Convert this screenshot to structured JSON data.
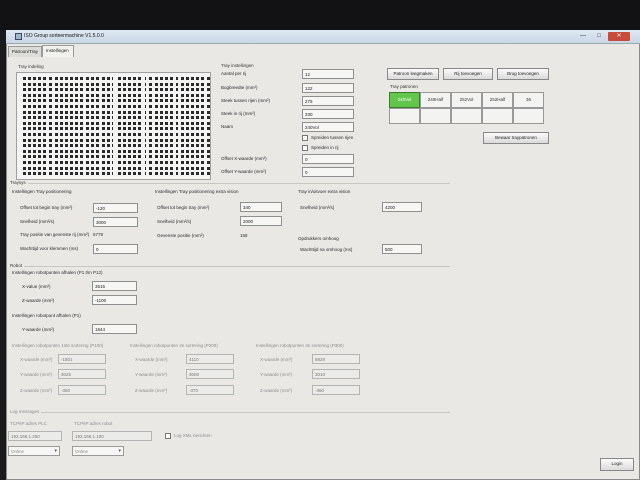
{
  "window": {
    "title": "ISO Group sorteermachine V1.5.0.0",
    "min_glyph": "—",
    "max_glyph": "□",
    "close_glyph": "✕"
  },
  "tabs": [
    {
      "label": "Patroon/Tray"
    },
    {
      "label": "Instellingen"
    }
  ],
  "tray_indeling": {
    "label": "Tray indeling"
  },
  "tray_instellingen": {
    "title": "Tray instellingen",
    "rows": [
      {
        "label": "Aantal per rij",
        "value": "12"
      },
      {
        "label": "Bugbreedte (mm²)",
        "value": "122"
      },
      {
        "label": "Steek tussen rijen (mm²)",
        "value": "275"
      },
      {
        "label": "Steek in rij (mm²)",
        "value": "330"
      },
      {
        "label": "Naam",
        "value": "240Vol"
      }
    ],
    "checkbox1": "Spreiden tussen rijen",
    "checkbox2": "Spreiden in rij",
    "offset_x_label": "Offset X-waarde (mm²)",
    "offset_x_value": "0",
    "offset_y_label": "Offset Y-waarde (mm²)",
    "offset_y_value": "0"
  },
  "patroon": {
    "btn_leegmaken": "Patroon leegmaken",
    "btn_rij": "Rij toevoegen",
    "btn_brug": "Brug toevoegen",
    "title": "Tray patronen",
    "cells": [
      "240Vol",
      "240Half",
      "252Vol",
      "252Half",
      "36"
    ],
    "btn_bewaar": "Bewaar traypatronen"
  },
  "traysys": {
    "title": "Traysys",
    "positionering_title": "Instellingen Tray positionering",
    "offset_label": "Offset tot begin tray (mm²)",
    "offset_value": "-120",
    "snelheid_label": "Snelheid (mm²/s)",
    "snelheid_value": "3000",
    "positie_label": "Tray positie van gevenste rij (mm²)",
    "positie_value": "5778",
    "wachttijd_label": "Wachttijd voor klemmen (ms)",
    "wachttijd_value": "0",
    "extra_title": "Instellingen Tray positionering extra vision",
    "extra_offset_label": "Offset tot begin tray (mm²)",
    "extra_offset_value": "340",
    "extra_snelheid_label": "Snelheid (mm²/s)",
    "extra_snelheid_value": "2000",
    "extra_positie_label": "Gevenste positie (mm²)",
    "extra_positie_value": "158",
    "uitvoer_title": "Tray in/uitvoer extra vision",
    "uitvoer_snelheid_label": "Snelheid (mm²/s)",
    "uitvoer_snelheid_value": "4200",
    "opdrukkers_title": "Opdrukkers omhoog",
    "opdrukkers_label": "Wachttijd na omhoog (ms)",
    "opdrukkers_value": "500"
  },
  "robot": {
    "title": "Robot",
    "afhalen_title": "Instellingen robotpunten afhalen (P1 t/m P12)",
    "x_label": "X-value (mm²)",
    "x_value": "3515",
    "z_label": "Z-waarde (mm²)",
    "z_value": "-1100",
    "afleggen_title": "Instellingen robotpunt afhalen (P1)",
    "y_label": "Y-waarde (mm²)",
    "y_value": "1844",
    "cols": [
      {
        "title": "Instellingen robotpunten 1ste sortering (P100)",
        "x": "-1501",
        "y": "3025",
        "z": "-360"
      },
      {
        "title": "Instellingen robotpunten 2e sortering (P200)",
        "x": "4110",
        "y": "3000",
        "z": "-370"
      },
      {
        "title": "Instellingen robotpunten 3e sortering (P300)",
        "x": "8828",
        "y": "3010",
        "z": "-360"
      }
    ],
    "col_x_label": "X-waarde (mm²)",
    "col_y_label": "Y-waarde (mm²)",
    "col_z_label": "Z-waarde (mm²)"
  },
  "log": {
    "title": "Log messages",
    "plc_label": "TCP/IP adres PLC",
    "plc_value": "192.168.1.250",
    "robot_label": "TCP/IP adres robot",
    "robot_value": "192.168.1.100",
    "xml_label": "Log XML berichten",
    "select1": "Online",
    "select2": "Online"
  },
  "login": {
    "label": "Login"
  }
}
